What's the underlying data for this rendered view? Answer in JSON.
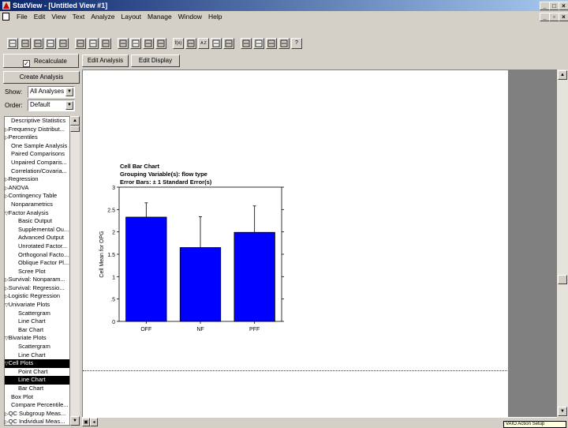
{
  "window": {
    "title": "StatView - [Untitled View #1]"
  },
  "menu": [
    "File",
    "Edit",
    "View",
    "Text",
    "Analyze",
    "Layout",
    "Manage",
    "Window",
    "Help"
  ],
  "toolbar_icons": [
    "new-icon",
    "open-icon",
    "folder-icon",
    "save-icon",
    "print-icon",
    "cut-icon",
    "copy-icon",
    "paste-icon",
    "link-icon",
    "view-icon",
    "table-icon",
    "dot-icon",
    "function-icon",
    "grid-icon",
    "sort-icon",
    "variables-icon",
    "brush-icon",
    "arrow-icon",
    "select-icon",
    "pencil-icon",
    "zoom-icon",
    "help-icon"
  ],
  "toolbar_labels": {
    "function": "f(x)",
    "sort": "A Z",
    "help": "?"
  },
  "controls": {
    "recalculate": "Recalculate",
    "recalculate_checked": true,
    "edit_analysis": "Edit Analysis",
    "edit_display": "Edit Display",
    "create_analysis": "Create Analysis",
    "show_label": "Show:",
    "show_value": "All Analyses",
    "order_label": "Order:",
    "order_value": "Default"
  },
  "analysis_list": [
    {
      "label": "Descriptive Statistics",
      "indent": 1,
      "arrow": "",
      "selected": false
    },
    {
      "label": "Frequency Distribut...",
      "indent": 0,
      "arrow": "right",
      "selected": false
    },
    {
      "label": "Percentiles",
      "indent": 0,
      "arrow": "right",
      "selected": false
    },
    {
      "label": "One Sample Analysis",
      "indent": 1,
      "arrow": "",
      "selected": false
    },
    {
      "label": "Paired Comparisons",
      "indent": 1,
      "arrow": "",
      "selected": false
    },
    {
      "label": "Unpaired Comparis...",
      "indent": 1,
      "arrow": "",
      "selected": false
    },
    {
      "label": "Correlation/Covaria...",
      "indent": 1,
      "arrow": "",
      "selected": false
    },
    {
      "label": "Regression",
      "indent": 0,
      "arrow": "right",
      "selected": false
    },
    {
      "label": "ANOVA",
      "indent": 0,
      "arrow": "right",
      "selected": false
    },
    {
      "label": "Contingency Table",
      "indent": 0,
      "arrow": "right",
      "selected": false
    },
    {
      "label": "Nonparametrics",
      "indent": 1,
      "arrow": "",
      "selected": false
    },
    {
      "label": "Factor Analysis",
      "indent": 0,
      "arrow": "down",
      "selected": false
    },
    {
      "label": "Basic Output",
      "indent": 2,
      "arrow": "",
      "selected": false
    },
    {
      "label": "Supplemental Ou...",
      "indent": 2,
      "arrow": "",
      "selected": false
    },
    {
      "label": "Advanced Output",
      "indent": 2,
      "arrow": "",
      "selected": false
    },
    {
      "label": "Unrotated Factor...",
      "indent": 2,
      "arrow": "",
      "selected": false
    },
    {
      "label": "Orthogonal Facto...",
      "indent": 2,
      "arrow": "",
      "selected": false
    },
    {
      "label": "Oblique Factor Pl...",
      "indent": 2,
      "arrow": "",
      "selected": false
    },
    {
      "label": "Scree Plot",
      "indent": 2,
      "arrow": "",
      "selected": false
    },
    {
      "label": "Survival: Nonparam...",
      "indent": 0,
      "arrow": "right",
      "selected": false
    },
    {
      "label": "Survival: Regressio...",
      "indent": 0,
      "arrow": "right",
      "selected": false
    },
    {
      "label": "Logistic Regression",
      "indent": 0,
      "arrow": "right",
      "selected": false
    },
    {
      "label": "Univariate Plots",
      "indent": 0,
      "arrow": "down",
      "selected": false
    },
    {
      "label": "Scattergram",
      "indent": 2,
      "arrow": "",
      "selected": false
    },
    {
      "label": "Line Chart",
      "indent": 2,
      "arrow": "",
      "selected": false
    },
    {
      "label": "Bar Chart",
      "indent": 2,
      "arrow": "",
      "selected": false
    },
    {
      "label": "Bivariate Plots",
      "indent": 0,
      "arrow": "down",
      "selected": false
    },
    {
      "label": "Scattergram",
      "indent": 2,
      "arrow": "",
      "selected": false
    },
    {
      "label": "Line Chart",
      "indent": 2,
      "arrow": "",
      "selected": false
    },
    {
      "label": "Cell Plots",
      "indent": 0,
      "arrow": "down",
      "selected": true
    },
    {
      "label": "Point Chart",
      "indent": 2,
      "arrow": "",
      "selected": false
    },
    {
      "label": "Line Chart",
      "indent": 2,
      "arrow": "",
      "selected": true
    },
    {
      "label": "Bar Chart",
      "indent": 2,
      "arrow": "",
      "selected": false
    },
    {
      "label": "Box Plot",
      "indent": 1,
      "arrow": "",
      "selected": false
    },
    {
      "label": "Compare Percentile...",
      "indent": 1,
      "arrow": "",
      "selected": false
    },
    {
      "label": "QC Subgroup Meas...",
      "indent": 0,
      "arrow": "right",
      "selected": false
    },
    {
      "label": "QC Individual Meas...",
      "indent": 0,
      "arrow": "right",
      "selected": false
    }
  ],
  "chart_data": {
    "type": "bar",
    "title": [
      "Cell Bar Chart",
      "Grouping Variable(s): flow type",
      "Error Bars: ± 1 Standard Error(s)"
    ],
    "categories": [
      "OFF",
      "NF",
      "PFF"
    ],
    "values": [
      2.33,
      1.65,
      1.99
    ],
    "errors": [
      0.32,
      0.69,
      0.59
    ],
    "ylabel": "Cell Mean for OPG",
    "xlabel": "",
    "ylim": [
      0,
      3
    ],
    "yticks": [
      0,
      0.5,
      1,
      1.5,
      2,
      2.5,
      3
    ],
    "ytick_labels": [
      "0",
      ".5",
      "1",
      "1.5",
      "2",
      "2.5",
      "3"
    ],
    "bar_color": "#0000ff",
    "grid": false
  },
  "tooltip": "VAIO Action Setup",
  "colors": {
    "title_start": "#0a246a",
    "title_end": "#a6caf0",
    "page_break": "#cc0000"
  }
}
